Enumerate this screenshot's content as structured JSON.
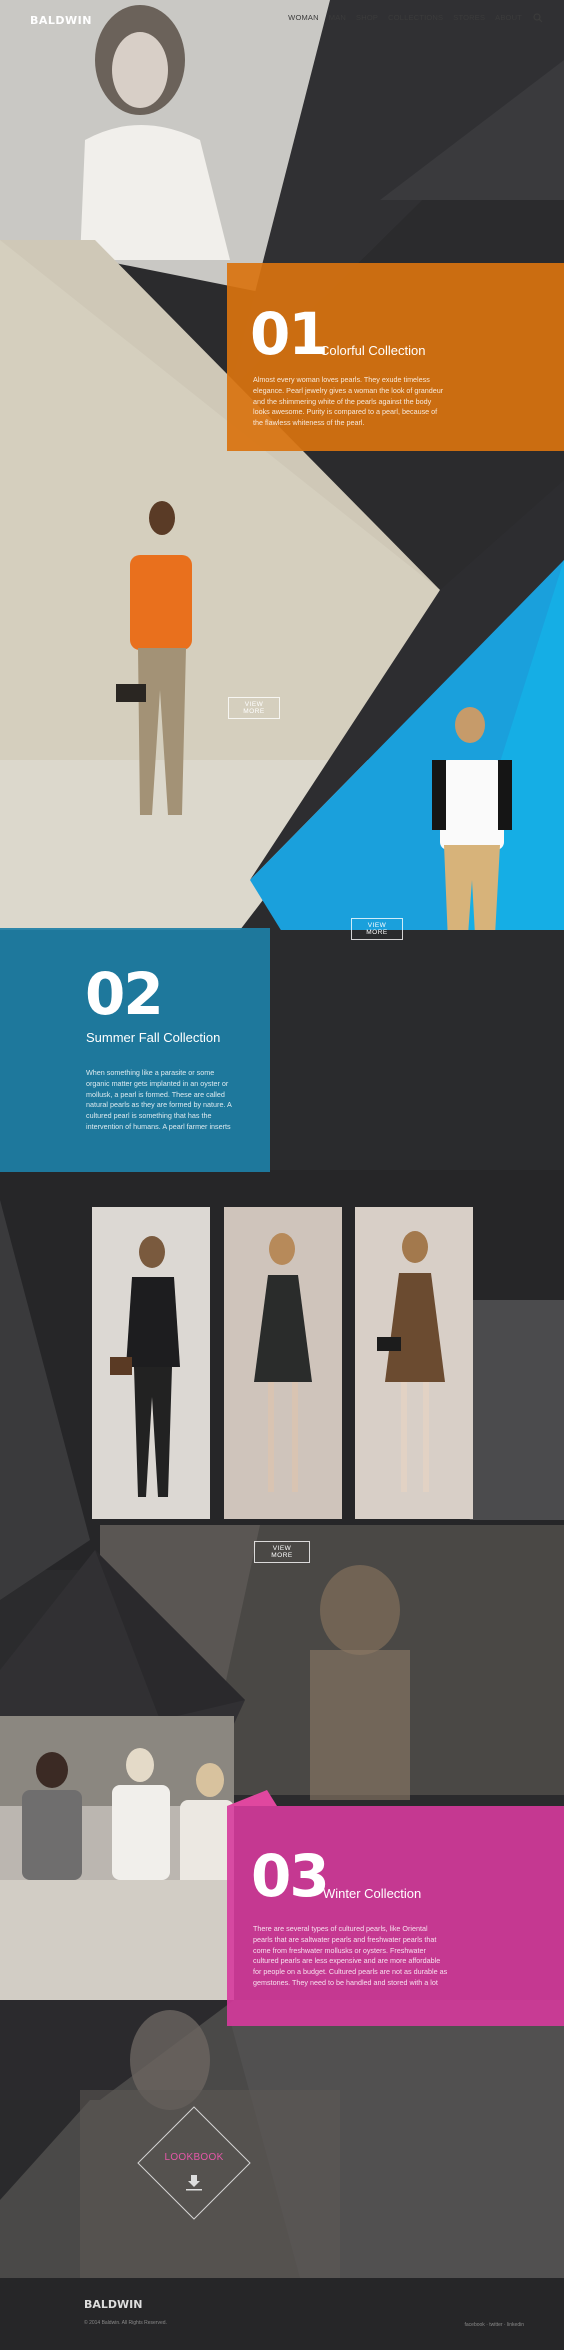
{
  "header": {
    "brand": "BALDWIN",
    "nav": [
      "WOMAN",
      "MAN",
      "SHOP",
      "COLLECTIONS",
      "STORES",
      "ABOUT"
    ],
    "search_icon": "search-icon"
  },
  "section1": {
    "number": "01",
    "title": "Colorful Collection",
    "text": "Almost every woman loves pearls. They exude timeless elegance. Pearl jewelry gives a woman the look of grandeur and the shimmering white of the pearls against the body looks awesome. Purity is compared to a pearl, because of the flawless whiteness of the pearl.",
    "color": "#d9730f",
    "button1": "VIEW MORE",
    "button2": "VIEW MORE"
  },
  "section2": {
    "number": "02",
    "title": "Summer Fall Collection",
    "text": "When something like a parasite or some organic matter gets implanted in an oyster or mollusk, a pearl is formed. These are called natural pearls as they are formed by nature. A cultured pearl is something that has the intervention of humans. A pearl farmer inserts",
    "color": "#1d7fa6",
    "button": "VIEW MORE"
  },
  "section3": {
    "number": "03",
    "title": "Winter Collection",
    "text": "There are several types of cultured pearls, like Oriental pearls that are saltwater pearls and freshwater pearls that come from freshwater mollusks or oysters. Freshwater cultured pearls are less expensive and are more affordable for people on a budget. Cultured pearls are not as durable as gemstones. They need to be handled and stored with a lot",
    "color": "#d63a9c"
  },
  "lookbook": {
    "label": "LOOKBOOK",
    "icon": "download-icon",
    "accent": "#e457a8"
  },
  "footer": {
    "brand": "BALDWIN",
    "copyright": "© 2014 Baldwin. All Rights Reserved.",
    "social": "facebook · twitter · linkedin"
  }
}
